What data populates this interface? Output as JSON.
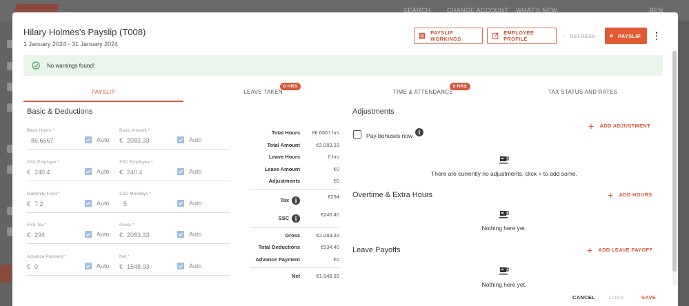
{
  "payslip": {
    "title": "Hilary Holmes's Payslip (T008)",
    "period": "1 January 2024 - 31 January 2024",
    "buttons": {
      "workings": "PAYSLIP WORKINGS",
      "employee_profile": "EMPLOYEE PROFILE",
      "refresh": "REFRESH",
      "payslip": "PAYSLIP"
    },
    "alert": "No warnings found!",
    "tabs": [
      {
        "label": "PAYSLIP",
        "badge": ""
      },
      {
        "label": "LEAVE TAKEN",
        "badge": "0 HRS"
      },
      {
        "label": "TIME & ATTENDANCE",
        "badge": "0 HRS"
      },
      {
        "label": "TAX STATUS AND RATES",
        "badge": ""
      }
    ],
    "basic": {
      "title": "Basic & Deductions",
      "auto_label": "Auto",
      "fields": [
        {
          "label": "Basic Hours *",
          "prefix": "",
          "value": "86.6667"
        },
        {
          "label": "Basic Amount *",
          "prefix": "€",
          "value": "2083.33"
        },
        {
          "label": "SSC Employer *",
          "prefix": "€",
          "value": "240.4"
        },
        {
          "label": "SSC Employee *",
          "prefix": "€",
          "value": "240.4"
        },
        {
          "label": "Maternity Fund *",
          "prefix": "€",
          "value": "7.2"
        },
        {
          "label": "SSC Mondays *",
          "prefix": "",
          "value": "5"
        },
        {
          "label": "FSS Tax *",
          "prefix": "€",
          "value": "294"
        },
        {
          "label": "Gross *",
          "prefix": "€",
          "value": "2083.33"
        },
        {
          "label": "Advance Payment *",
          "prefix": "€",
          "value": "0"
        },
        {
          "label": "Net *",
          "prefix": "€",
          "value": "1548.93"
        }
      ]
    },
    "summary": [
      {
        "key": "Total Hours",
        "value": "86.6667 hrs"
      },
      {
        "key": "Total Amount",
        "value": "€2,083.33"
      },
      {
        "key": "Leave Hours",
        "value": "0 hrs"
      },
      {
        "key": "Leave Amount",
        "value": "€0"
      },
      {
        "key": "Adjustments",
        "value": "€0"
      },
      {
        "key": "Tax",
        "value": "€294"
      },
      {
        "key": "SSC",
        "value": "€240.40"
      },
      {
        "key": "Gross",
        "value": "€2,083.33"
      },
      {
        "key": "Total Deductions",
        "value": "€534.40"
      },
      {
        "key": "Advance Payment",
        "value": "€0"
      },
      {
        "key": "Net",
        "value": "€1,548.93"
      }
    ],
    "adjustments": {
      "title": "Adjustments",
      "pay_bonuses_label": "Pay bonuses now",
      "add_label": "ADD ADJUSTMENT",
      "empty_text": "There are currently no adjustments, click + to add some."
    },
    "overtime": {
      "title": "Overtime & Extra Hours",
      "add_label": "ADD HOURS",
      "empty_text": "Nothing here yet."
    },
    "leave_payoffs": {
      "title": "Leave Payoffs",
      "add_label": "ADD LEAVE PAYOFF",
      "empty_text": "Nothing here yet."
    },
    "footer": {
      "cancel": "CANCEL",
      "lock": "LOCK",
      "save": "SAVE"
    }
  },
  "background": {
    "topbar_items": [
      "SEARCH",
      "CHANGE ACCOUNT",
      "WHAT'S NEW",
      "BEN"
    ]
  },
  "colors": {
    "accent": "#d9573a",
    "alert_bg": "#e9f4ea",
    "checkbox": "#9fbfe0"
  }
}
